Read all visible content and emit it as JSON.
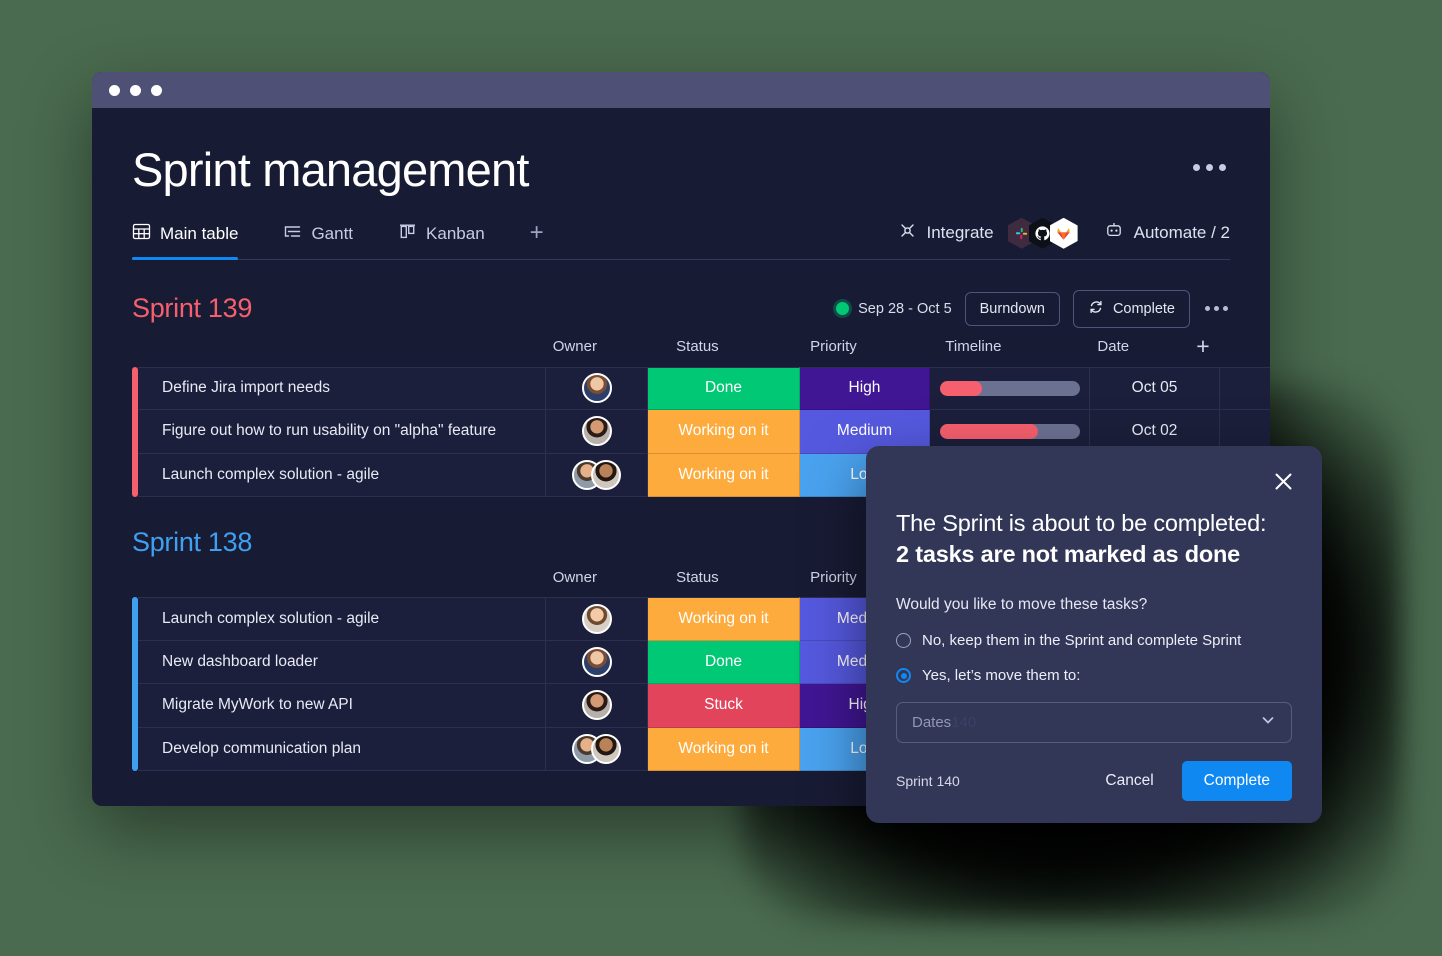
{
  "background_color": "#4a6b4f",
  "window": {
    "chrome_color": "#4e5175",
    "body_color": "#181b34",
    "dots": [
      "dot-1",
      "dot-2",
      "dot-3"
    ]
  },
  "header": {
    "title": "Sprint management",
    "menu_icon": "kebab-menu-icon"
  },
  "tabs": [
    {
      "label": "Main table",
      "icon": "table-icon",
      "active": true
    },
    {
      "label": "Gantt",
      "icon": "gantt-icon",
      "active": false
    },
    {
      "label": "Kanban",
      "icon": "kanban-icon",
      "active": false
    }
  ],
  "tab_add_label": "+",
  "toolbar": {
    "integrate_label": "Integrate",
    "integrate_icon": "integrate-plug-icon",
    "integrations": [
      {
        "name": "slack-icon",
        "color": "#4a154b"
      },
      {
        "name": "github-icon",
        "color": "#0d1117"
      },
      {
        "name": "gitlab-icon",
        "color": "#ffffff"
      }
    ],
    "automate_label": "Automate / 2",
    "automate_icon": "robot-icon"
  },
  "columns": [
    "Owner",
    "Status",
    "Priority",
    "Timeline",
    "Date"
  ],
  "add_column_label": "+",
  "accent_colors": {
    "sprint_139": "#f65f6e",
    "sprint_138": "#3fa0f0",
    "tab_underline": "#0f88f2",
    "primary_button": "#0f88f2",
    "live_dot": "#00c875"
  },
  "status_colors": {
    "Done": "#00c875",
    "Working on it": "#fdab3d",
    "Stuck": "#e2445c"
  },
  "priority_colors": {
    "High": "#401694",
    "Medium": "#5559df",
    "Low": "#4aa3f0"
  },
  "groups": [
    {
      "title": "Sprint 139",
      "title_color": "#f65f6e",
      "accent": "#f65f6e",
      "meta": {
        "date_range": "Sep 28 - Oct 5",
        "burndown_label": "Burndown",
        "complete_label": "Complete",
        "complete_icon": "sprint-cycle-icon",
        "menu_icon": "kebab-menu-icon"
      },
      "rows": [
        {
          "name": "Define Jira import needs",
          "owners": 1,
          "status": "Done",
          "priority": "High",
          "timeline_percent": 30,
          "date": "Oct 05"
        },
        {
          "name": "Figure out how to run usability on \"alpha\" feature",
          "owners": 1,
          "status": "Working on it",
          "priority": "Medium",
          "timeline_percent": 70,
          "date": "Oct 02"
        },
        {
          "name": "Launch complex solution - agile",
          "owners": 2,
          "status": "Working on it",
          "priority": "Low",
          "timeline_percent": 0,
          "date": ""
        }
      ]
    },
    {
      "title": "Sprint 138",
      "title_color": "#3fa0f0",
      "accent": "#3fa0f0",
      "meta": null,
      "rows": [
        {
          "name": "Launch complex solution - agile",
          "owners": 1,
          "status": "Working on it",
          "priority": "Medium",
          "timeline_percent": 0,
          "date": ""
        },
        {
          "name": "New dashboard loader",
          "owners": 1,
          "status": "Done",
          "priority": "Medium",
          "timeline_percent": 0,
          "date": ""
        },
        {
          "name": "Migrate MyWork to new API",
          "owners": 1,
          "status": "Stuck",
          "priority": "High",
          "timeline_percent": 0,
          "date": ""
        },
        {
          "name": "Develop communication plan",
          "owners": 2,
          "status": "Working on it",
          "priority": "Low",
          "timeline_percent": 0,
          "date": ""
        }
      ]
    }
  ],
  "modal": {
    "close_icon": "close-x-icon",
    "heading_line1": "The Sprint is about to be completed:",
    "heading_line2": "2 tasks are not marked as done",
    "question": "Would you like to move these tasks?",
    "options": [
      {
        "label": "No, keep them in the Sprint and complete Sprint",
        "selected": false
      },
      {
        "label": "Yes, let’s move them to:",
        "selected": true
      }
    ],
    "select_value": "Dates",
    "select_ghost": "140",
    "select_icon": "chevron-down-icon",
    "footer_note": "Sprint 140",
    "cancel_label": "Cancel",
    "complete_label": "Complete"
  }
}
